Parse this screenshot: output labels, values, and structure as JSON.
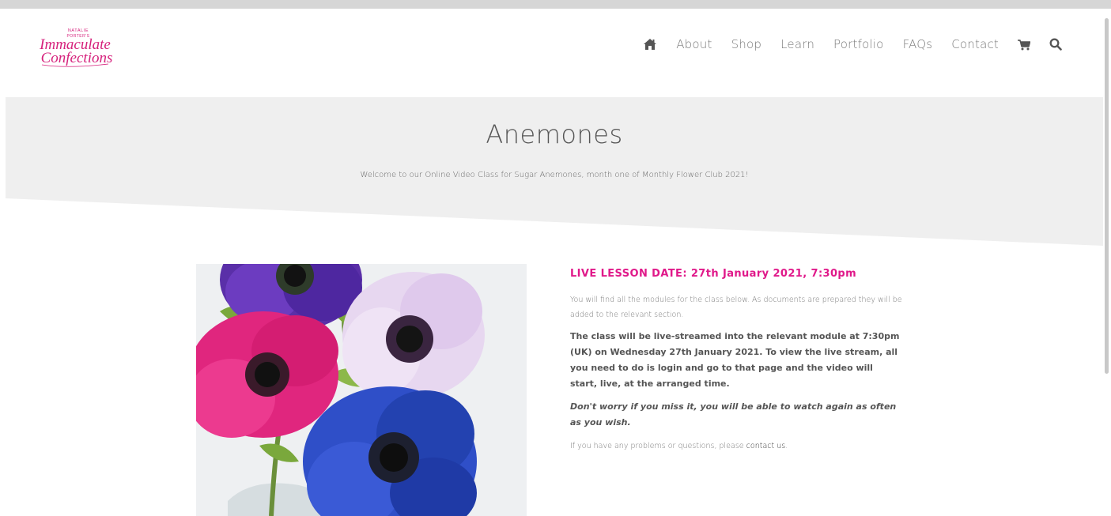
{
  "logo": {
    "line1": "NATALIE",
    "line2": "PORTER'S",
    "line3": "Immaculate",
    "line4": "Confections",
    "color": "#d6217c"
  },
  "nav": {
    "items": [
      "About",
      "Shop",
      "Learn",
      "Portfolio",
      "FAQs",
      "Contact"
    ],
    "home_icon": "home-icon",
    "cart_icon": "cart-icon",
    "search_icon": "search-icon"
  },
  "hero": {
    "title": "Anemones",
    "subtitle": "Welcome to our Online Video Class for Sugar Anemones, month one of Monthly Flower Club 2021!",
    "band_color": "#efefef"
  },
  "content": {
    "lesson_date": "LIVE LESSON DATE: 27th January 2021, 7:30pm",
    "intro": "You will find all the modules for the class below. As documents are prepared they will be added to the relevant section.",
    "live_stream": "The class will be live-streamed into the relevant module at 7:30pm (UK) on Wednesday 27th January 2021. To view the live stream, all you need to do is login and go to that page and the video will start, live, at the arranged time.",
    "dont_worry": "Don't worry if you miss it, you will be able to watch again as often as you wish.",
    "problems_prefix": "If you have any problems or questions, please ",
    "contact_link": "contact us",
    "problems_suffix": ".",
    "accent_color": "#e0198a"
  }
}
